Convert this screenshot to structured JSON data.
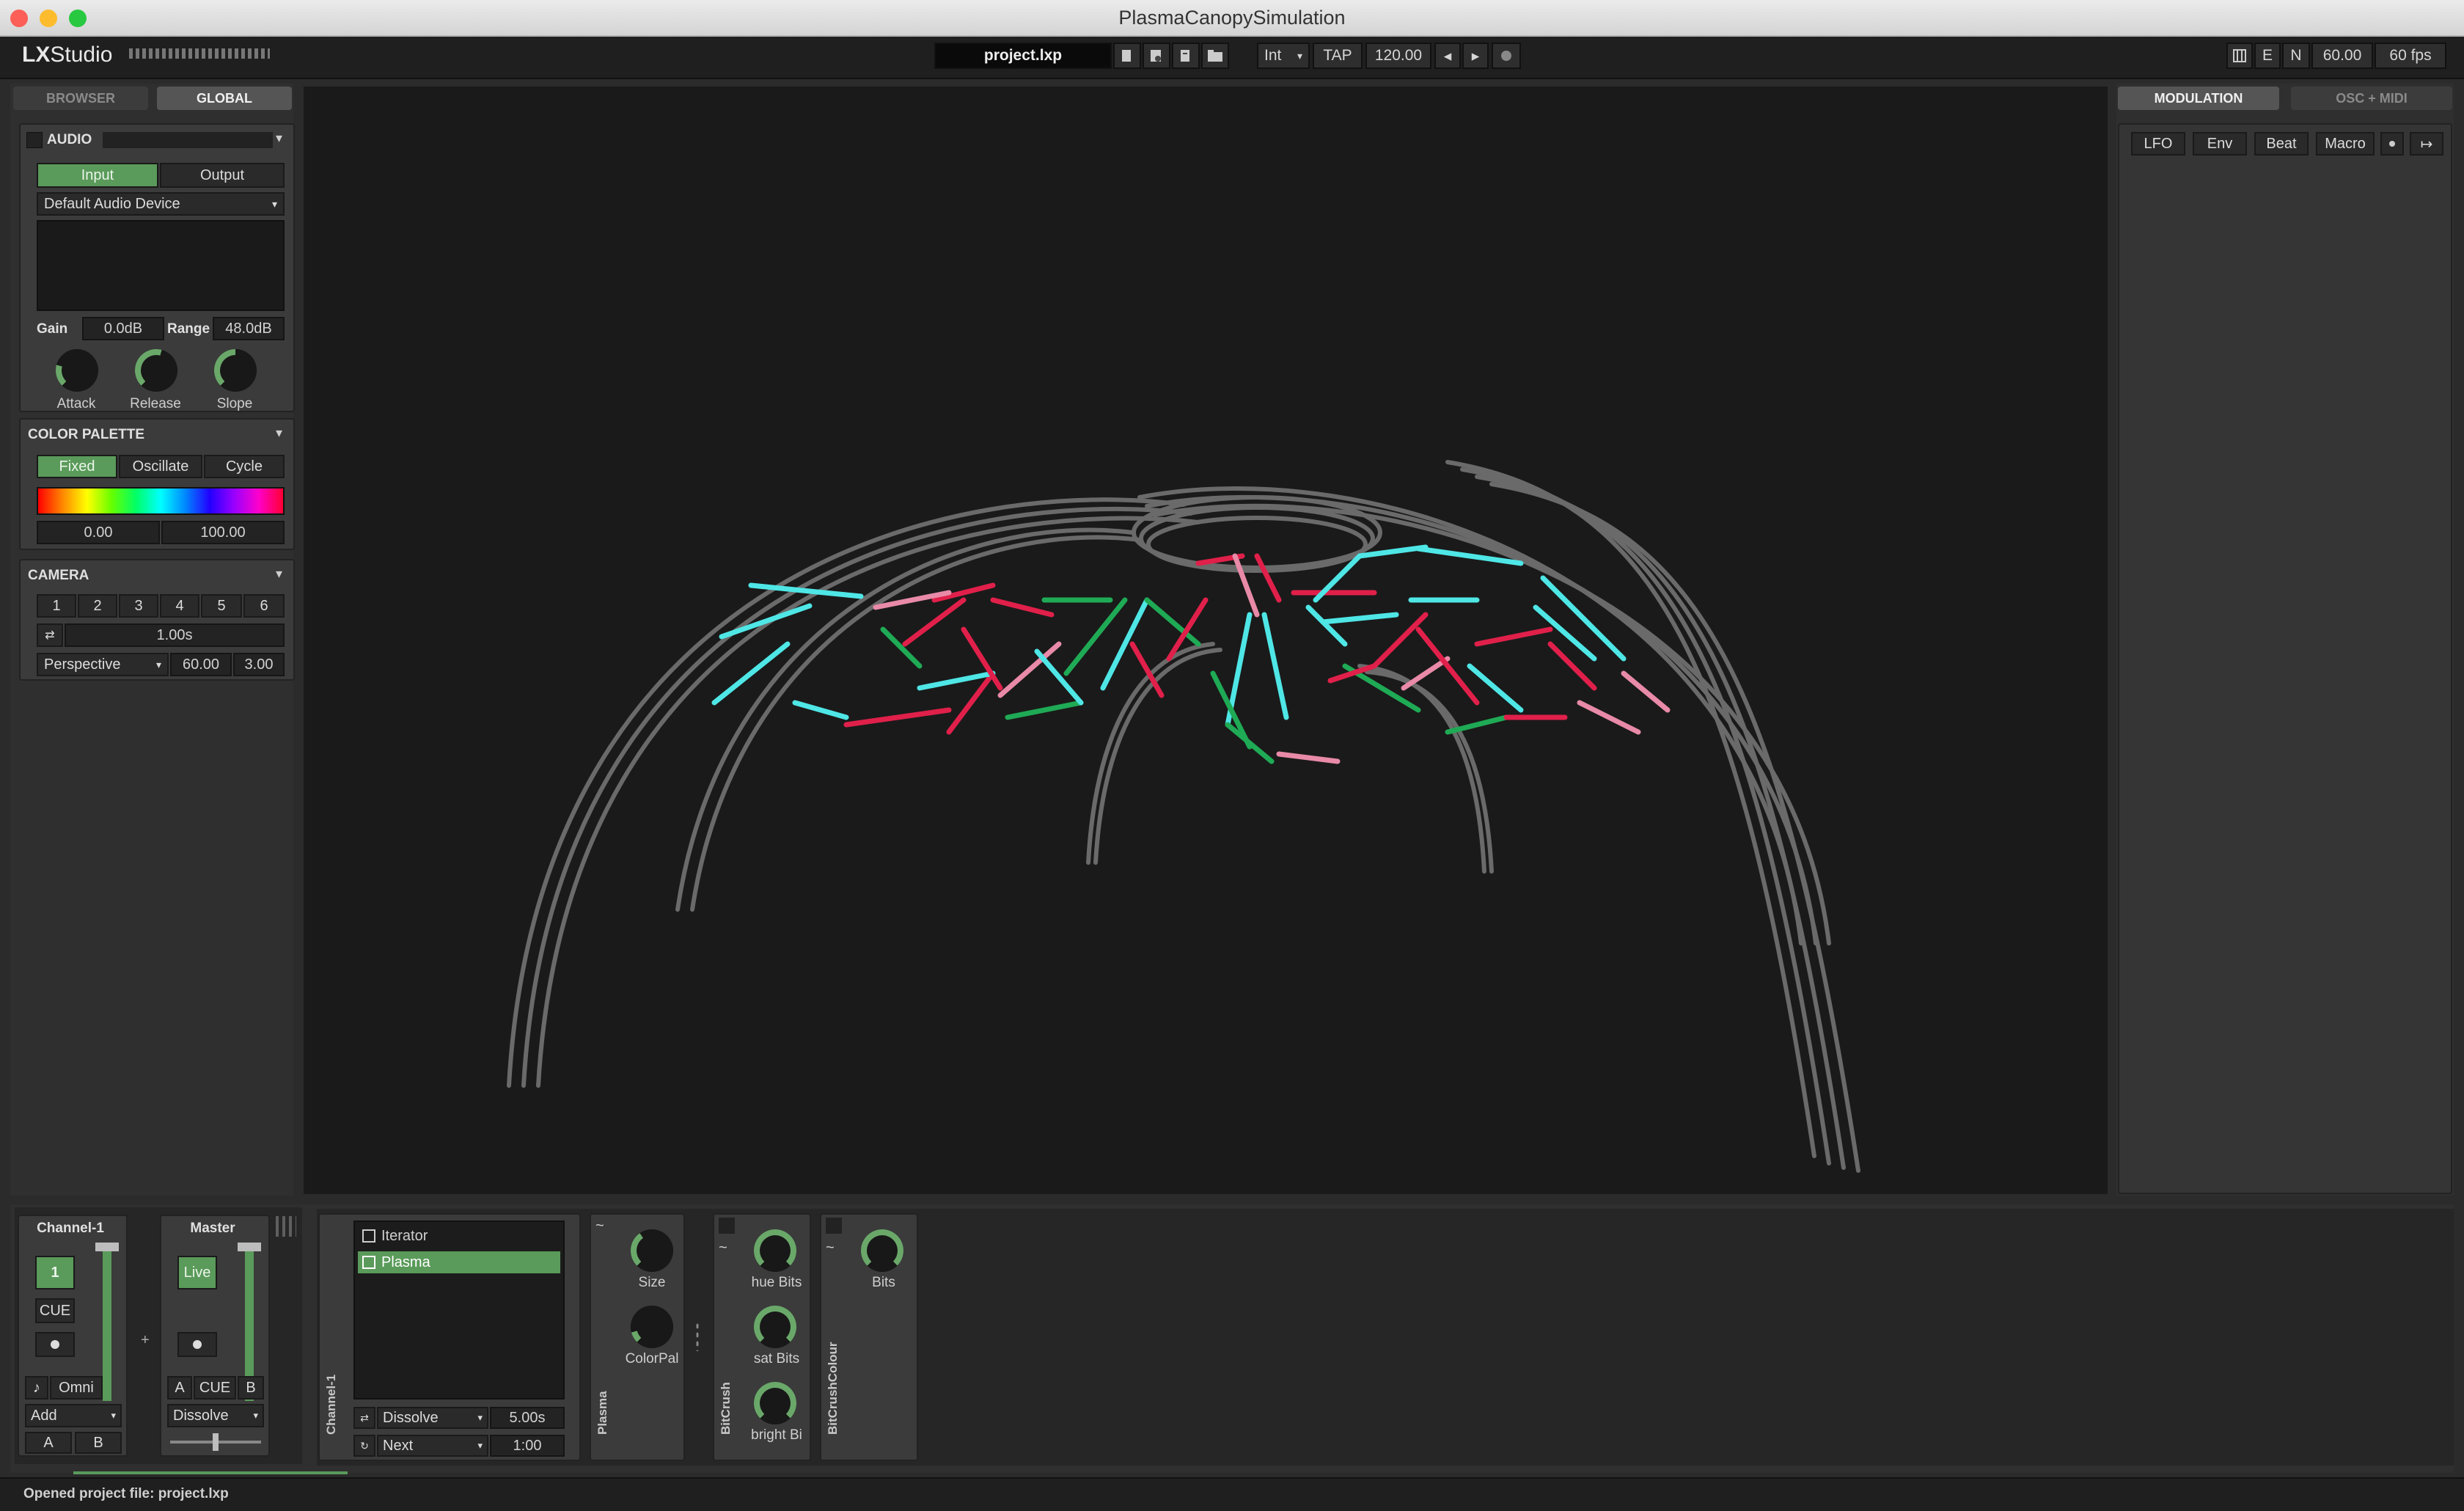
{
  "window": {
    "title": "PlasmaCanopySimulation"
  },
  "toolbar": {
    "logo_lx": "LX",
    "logo_studio": "Studio",
    "project_file": "project.lxp",
    "clock_mode": "Int",
    "tap": "TAP",
    "bpm": "120.00",
    "nudge_down": "◂",
    "nudge_up": "▸",
    "flag_e": "E",
    "flag_n": "N",
    "frame_rate": "60.00",
    "fps": "60 fps"
  },
  "left_tabs": {
    "browser": "BROWSER",
    "global": "GLOBAL"
  },
  "audio": {
    "title": "AUDIO",
    "input": "Input",
    "output": "Output",
    "device": "Default Audio Device",
    "gain_label": "Gain",
    "gain_value": "0.0dB",
    "range_label": "Range",
    "range_value": "48.0dB",
    "attack": "Attack",
    "release": "Release",
    "slope": "Slope"
  },
  "palette": {
    "title": "COLOR PALETTE",
    "fixed": "Fixed",
    "oscillate": "Oscillate",
    "cycle": "Cycle",
    "min": "0.00",
    "max": "100.00"
  },
  "camera": {
    "title": "CAMERA",
    "presets": [
      "1",
      "2",
      "3",
      "4",
      "5",
      "6"
    ],
    "duration": "1.00s",
    "projection": "Perspective",
    "fov": "60.00",
    "depth": "3.00"
  },
  "right_tabs": {
    "modulation": "MODULATION",
    "osc_midi": "OSC + MIDI"
  },
  "modulators": [
    "LFO",
    "Env",
    "Beat",
    "Macro"
  ],
  "channel": {
    "name": "Channel-1",
    "number": "1",
    "cue": "CUE",
    "omni": "Omni",
    "blend": "Add",
    "a": "A",
    "b": "B",
    "vertical_label": "Channel-1"
  },
  "master": {
    "name": "Master",
    "live": "Live",
    "a": "A",
    "cue": "CUE",
    "b": "B",
    "transition": "Dissolve"
  },
  "pattern_list": {
    "items": [
      "Iterator",
      "Plasma"
    ],
    "transition": "Dissolve",
    "transition_time": "5.00s",
    "auto": "Next",
    "auto_time": "1:00"
  },
  "devices": {
    "plasma": {
      "label": "Plasma",
      "size": "Size",
      "colorpal": "ColorPal"
    },
    "bitcrush": {
      "label": "BitCrush",
      "hue": "hue Bits",
      "sat": "sat Bits",
      "bright": "bright Bi"
    },
    "bitcrushcolour": {
      "label": "BitCrushColour",
      "bits": "Bits"
    }
  },
  "status": {
    "message": "Opened project file: project.lxp"
  },
  "colors": {
    "accent": "#5a9a5a",
    "structure": "#6a6a6a",
    "led_cyan": "#4fe6e6",
    "led_red": "#e0204a",
    "led_pink": "#e88aa8",
    "led_green": "#1faa55"
  }
}
